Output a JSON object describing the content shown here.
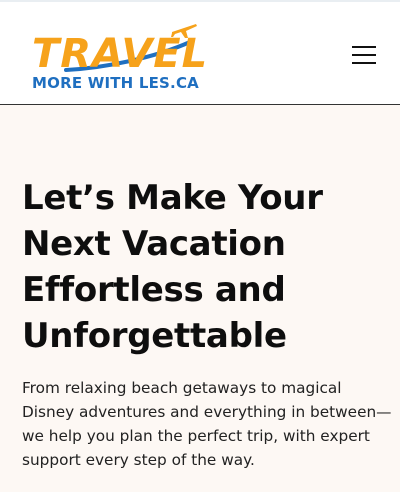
{
  "header": {
    "logo": {
      "main": "TRAVEL",
      "sub": "MORE WITH LES.CA"
    },
    "menu_icon": "hamburger-menu-icon"
  },
  "hero": {
    "title_lines": [
      "Let’s Make Your",
      "Next Vacation",
      "Effortless and",
      "Unforgettable"
    ],
    "text_lines": [
      "From relaxing beach getaways to magical",
      "Disney adventures and everything in between—",
      "we help you plan the perfect trip, with expert",
      "support every step of the way."
    ]
  },
  "colors": {
    "logo_orange": "#f6a21b",
    "logo_blue": "#1f6fc0",
    "hero_background": "#fdf8f4",
    "text": "#0e0e0e"
  }
}
